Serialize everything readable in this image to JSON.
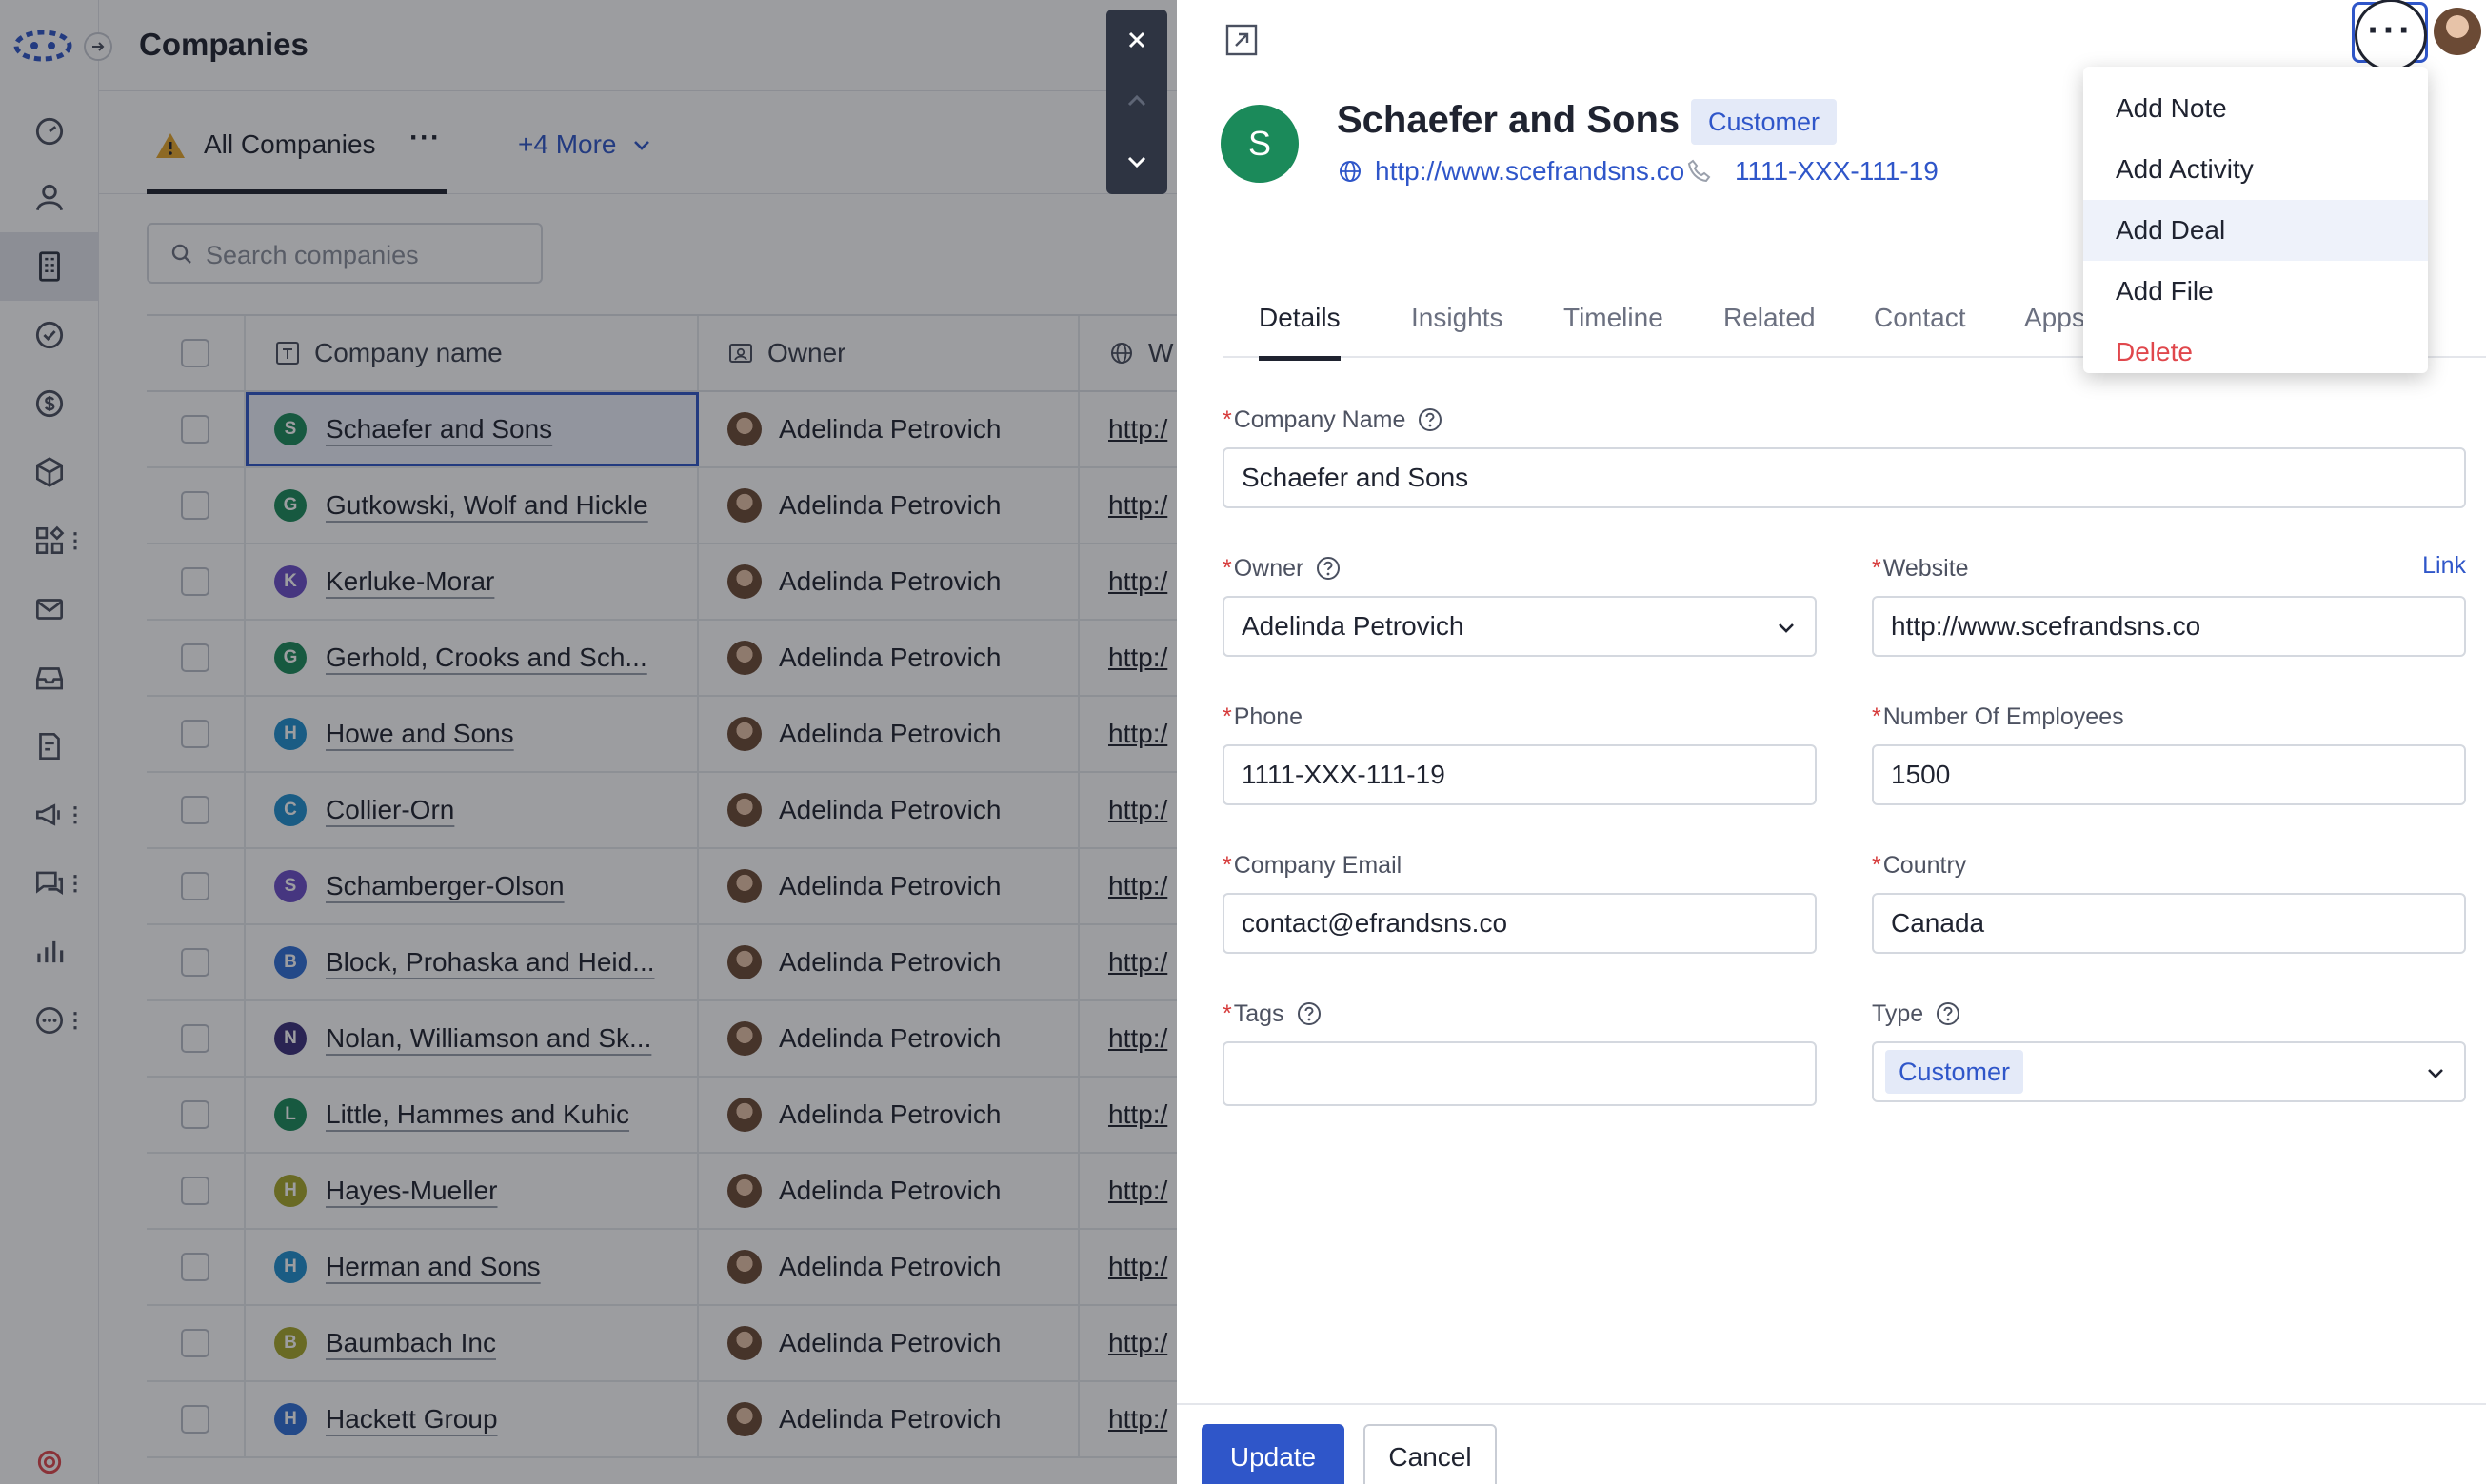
{
  "app": {
    "page_title": "Companies"
  },
  "views": {
    "active": "All Companies",
    "more": "+4 More"
  },
  "search": {
    "placeholder": "Search companies"
  },
  "table": {
    "columns": [
      "Company name",
      "Owner",
      "W"
    ],
    "rows": [
      {
        "initial": "S",
        "color": "#1b8a5a",
        "name": "Schaefer and Sons",
        "owner": "Adelinda Petrovich",
        "web": "http:/"
      },
      {
        "initial": "G",
        "color": "#1b8a5a",
        "name": "Gutkowski, Wolf and Hickle",
        "owner": "Adelinda Petrovich",
        "web": "http:/"
      },
      {
        "initial": "K",
        "color": "#6b4fc9",
        "name": "Kerluke-Morar",
        "owner": "Adelinda Petrovich",
        "web": "http:/"
      },
      {
        "initial": "G",
        "color": "#1b8a5a",
        "name": "Gerhold, Crooks and Sch...",
        "owner": "Adelinda Petrovich",
        "web": "http:/"
      },
      {
        "initial": "H",
        "color": "#1f8fcf",
        "name": "Howe and Sons",
        "owner": "Adelinda Petrovich",
        "web": "http:/"
      },
      {
        "initial": "C",
        "color": "#1f8fcf",
        "name": "Collier-Orn",
        "owner": "Adelinda Petrovich",
        "web": "http:/"
      },
      {
        "initial": "S",
        "color": "#6b4fc9",
        "name": "Schamberger-Olson",
        "owner": "Adelinda Petrovich",
        "web": "http:/"
      },
      {
        "initial": "B",
        "color": "#2f6fd6",
        "name": "Block, Prohaska and Heid...",
        "owner": "Adelinda Petrovich",
        "web": "http:/"
      },
      {
        "initial": "N",
        "color": "#3b2f7a",
        "name": "Nolan, Williamson and Sk...",
        "owner": "Adelinda Petrovich",
        "web": "http:/"
      },
      {
        "initial": "L",
        "color": "#1b8a5a",
        "name": "Little, Hammes and Kuhic",
        "owner": "Adelinda Petrovich",
        "web": "http:/"
      },
      {
        "initial": "H",
        "color": "#a7a72a",
        "name": "Hayes-Mueller",
        "owner": "Adelinda Petrovich",
        "web": "http:/"
      },
      {
        "initial": "H",
        "color": "#1f8fcf",
        "name": "Herman and Sons",
        "owner": "Adelinda Petrovich",
        "web": "http:/"
      },
      {
        "initial": "B",
        "color": "#a7a72a",
        "name": "Baumbach Inc",
        "owner": "Adelinda Petrovich",
        "web": "http:/"
      },
      {
        "initial": "H",
        "color": "#2f6fd6",
        "name": "Hackett Group",
        "owner": "Adelinda Petrovich",
        "web": "http:/"
      }
    ]
  },
  "detail": {
    "initial": "S",
    "name": "Schaefer and Sons",
    "tag": "Customer",
    "website": "http://www.scefrandsns.co",
    "phone": "1111-XXX-111-19",
    "tabs": [
      "Details",
      "Insights",
      "Timeline",
      "Related",
      "Contact",
      "Apps"
    ],
    "fields": {
      "company_name": {
        "label": "Company Name",
        "value": "Schaefer and Sons"
      },
      "owner": {
        "label": "Owner",
        "value": "Adelinda Petrovich"
      },
      "website": {
        "label": "Website",
        "value": "http://www.scefrandsns.co",
        "link": "Link"
      },
      "phone": {
        "label": "Phone",
        "value": "1111-XXX-111-19"
      },
      "employees": {
        "label": "Number Of Employees",
        "value": "1500"
      },
      "email": {
        "label": "Company Email",
        "value": "contact@efrandsns.co"
      },
      "country": {
        "label": "Country",
        "value": "Canada"
      },
      "tags": {
        "label": "Tags",
        "value": ""
      },
      "type": {
        "label": "Type",
        "value": "Customer"
      }
    },
    "buttons": {
      "update": "Update",
      "cancel": "Cancel"
    }
  },
  "menu": {
    "items": [
      {
        "label": "Add Note"
      },
      {
        "label": "Add Activity"
      },
      {
        "label": "Add Deal"
      },
      {
        "label": "Add File"
      },
      {
        "label": "Delete"
      }
    ]
  },
  "colors": {
    "accent": "#2f56c9",
    "danger": "#e0474c",
    "selected_badge": "#1b8a5a"
  }
}
